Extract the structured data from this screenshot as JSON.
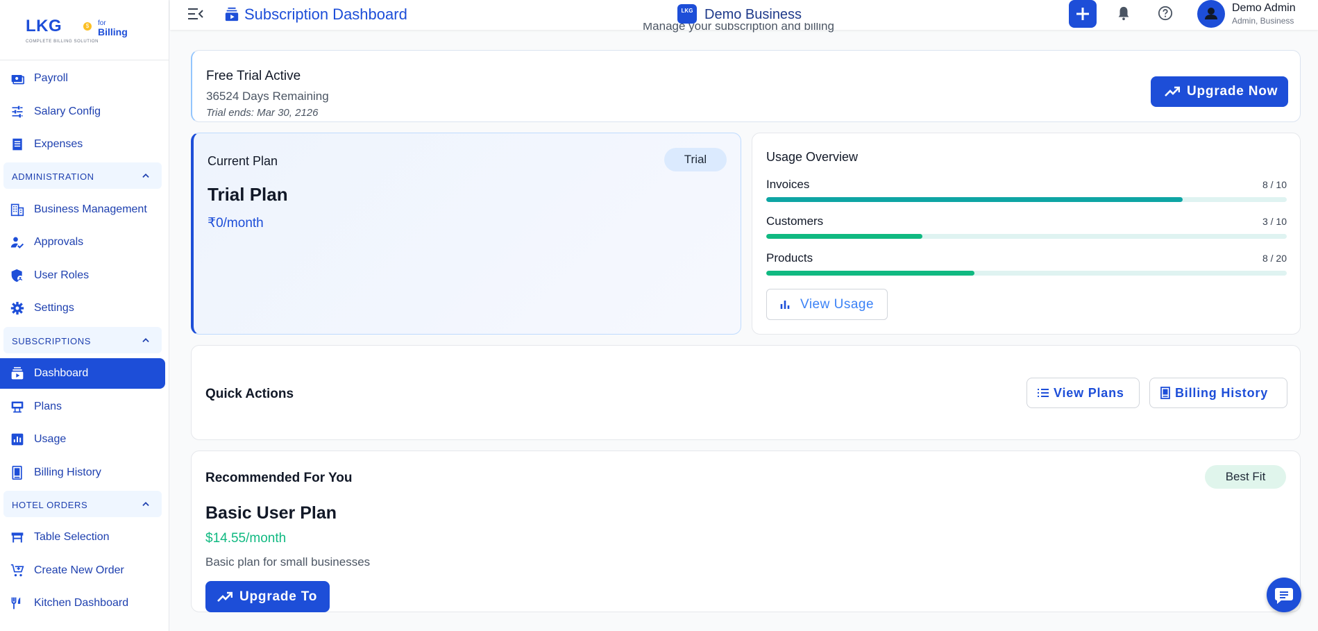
{
  "brand": {
    "logo_text": "LKG",
    "for_text": "for",
    "billing_text": "Billing",
    "tagline": "COMPLETE BILLING SOLUTION"
  },
  "sidebar": {
    "items_top": [
      {
        "label": "Payroll",
        "icon": "payroll-icon"
      },
      {
        "label": "Salary Config",
        "icon": "sliders-icon"
      },
      {
        "label": "Expenses",
        "icon": "receipt-icon"
      }
    ],
    "sections": [
      {
        "label": "ADMINISTRATION",
        "items": [
          {
            "label": "Business Management",
            "icon": "building-icon"
          },
          {
            "label": "Approvals",
            "icon": "user-check-icon"
          },
          {
            "label": "User Roles",
            "icon": "shield-icon"
          },
          {
            "label": "Settings",
            "icon": "gear-icon"
          }
        ]
      },
      {
        "label": "SUBSCRIPTIONS",
        "items": [
          {
            "label": "Dashboard",
            "icon": "subscriptions-icon",
            "active": true
          },
          {
            "label": "Plans",
            "icon": "plans-icon"
          },
          {
            "label": "Usage",
            "icon": "bar-chart-icon"
          },
          {
            "label": "Billing History",
            "icon": "receipt-long-icon"
          }
        ]
      },
      {
        "label": "HOTEL ORDERS",
        "items": [
          {
            "label": "Table Selection",
            "icon": "table-icon"
          },
          {
            "label": "Create New Order",
            "icon": "cart-icon"
          },
          {
            "label": "Kitchen Dashboard",
            "icon": "utensils-icon"
          }
        ]
      }
    ]
  },
  "topbar": {
    "title": "Subscription Dashboard",
    "business_logo": "LKG",
    "business_name": "Demo Business",
    "user_name": "Demo Admin",
    "user_role": "Admin, Business"
  },
  "page": {
    "subtitle": "Manage your subscription and billing"
  },
  "trial": {
    "title": "Free Trial Active",
    "days_remaining": "36524 Days Remaining",
    "ends": "Trial ends: Mar 30, 2126",
    "upgrade_label": "Upgrade Now"
  },
  "current_plan": {
    "label": "Current Plan",
    "badge": "Trial",
    "name": "Trial Plan",
    "price": "₹0/month"
  },
  "usage": {
    "title": "Usage Overview",
    "rows": [
      {
        "name": "Invoices",
        "count": "8 / 10",
        "fraction": 0.8,
        "color": "#0ea5a4"
      },
      {
        "name": "Customers",
        "count": "3 / 10",
        "fraction": 0.3,
        "color": "#10b981"
      },
      {
        "name": "Products",
        "count": "8 / 20",
        "fraction": 0.4,
        "color": "#10b981"
      }
    ],
    "view_label": "View Usage"
  },
  "quick_actions": {
    "title": "Quick Actions",
    "view_plans": "View Plans",
    "billing_history": "Billing History"
  },
  "recommended": {
    "title": "Recommended For You",
    "badge": "Best Fit",
    "plan_name": "Basic User Plan",
    "price": "$14.55/month",
    "description": "Basic plan for small businesses",
    "upgrade_label": "Upgrade To"
  },
  "colors": {
    "primary": "#1d4ed8",
    "success": "#10b981",
    "teal": "#0ea5a4"
  }
}
